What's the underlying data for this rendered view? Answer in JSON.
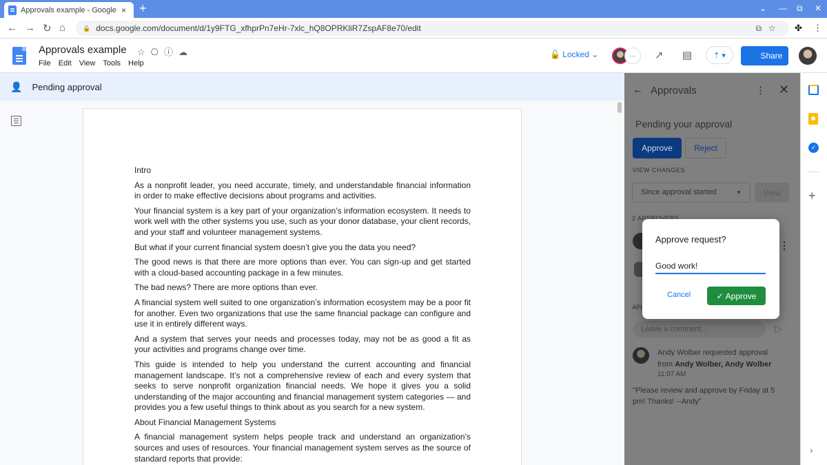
{
  "browser": {
    "tab_title": "Approvals example - Google Doc",
    "tab_close": "×",
    "new_tab": "+",
    "url": "docs.google.com/document/d/1y9FTG_xfhprPn7eHr-7xlc_hQ8OPRKliR7ZspAF8e70/edit",
    "nav": {
      "back": "←",
      "forward": "→",
      "reload": "↻",
      "home": "⌂"
    },
    "window": {
      "chevron": "⌄",
      "minimize": "—",
      "restore": "⧉",
      "close": "✕"
    }
  },
  "docs": {
    "title": "Approvals example",
    "menu": [
      "File",
      "Edit",
      "View",
      "Tools",
      "Help"
    ],
    "locked_label": "Locked",
    "share_label": "Share",
    "brand_color": "#4285f4",
    "accent": "#1a73e8"
  },
  "banner": {
    "text": "Pending approval"
  },
  "document": {
    "paragraphs": [
      "Intro",
      "As a nonprofit leader, you need accurate, timely, and understandable financial information in order to make effective decisions about programs and activities.",
      "Your financial system is a key part of your organization’s information ecosystem. It needs to work well with the other systems you use, such as your donor database, your client records, and your staff and volunteer management systems.",
      "But what if your current financial system doesn’t give you the data you need?",
      "The good news is that there are more options than ever. You can sign-up and get started with a cloud-based accounting package in a few minutes.",
      "The bad news? There are more options than ever.",
      "A financial system well suited to one organization’s information ecosystem may be a poor fit for another. Even two organizations that use the same financial package can configure and use it in entirely different ways.",
      "And a system that serves your needs and processes today, may not be as good a fit as your activities and programs change over time.",
      "This guide is intended to help you understand the current accounting and financial management landscape. It’s not a comprehensive review of each and every system that seeks to serve nonprofit organization financial needs. We hope it gives you a solid understanding of the major accounting and financial management system categories — and provides you a few useful things to think about as you search for a new system.",
      "About Financial Management Systems",
      "A financial management system helps people track and understand an organization’s sources and uses of resources. Your financial management system serves as the source of standard reports that provide:"
    ]
  },
  "approvals": {
    "title": "Approvals",
    "pending_heading": "Pending your approval",
    "approve_label": "Approve",
    "reject_label": "Reject",
    "view_changes_label": "VIEW CHANGES",
    "since_select": "Since approval started",
    "view_label": "View",
    "approvers_label": "2 APPROVERS",
    "ap_label": "API",
    "comment_placeholder": "Leave a comment...",
    "request": {
      "requester": "Andy Wolber",
      "action": " requested approval from ",
      "approvers": "Andy Wolber, Andy Wolber",
      "time": "11:07 AM",
      "message": "\"Please review and approve by Friday at 5 pm! Thanks! --Andy\""
    }
  },
  "dialog": {
    "title": "Approve request?",
    "input_value": "Good work!",
    "cancel_label": "Cancel",
    "approve_label": "Approve",
    "approve_color": "#1e8e3e"
  },
  "icons": {
    "check": "✓",
    "star": "☆",
    "more": "⋮",
    "close": "✕",
    "back": "←",
    "send": "▷",
    "plus": "+",
    "chevron_right": "›"
  }
}
